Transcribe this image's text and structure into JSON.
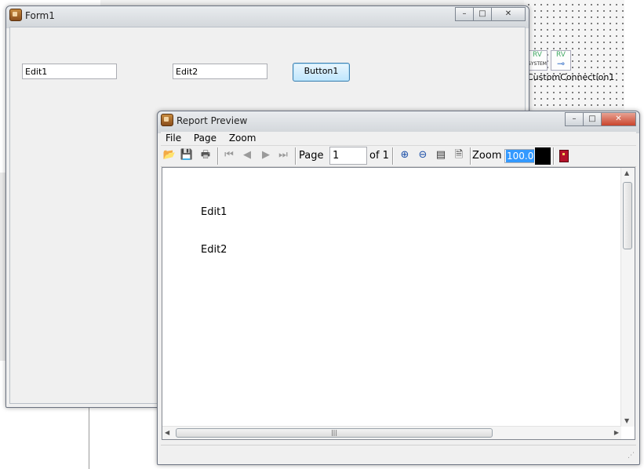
{
  "ide": {
    "component_label": "CustomConnection1",
    "icon1_text": "RV",
    "icon1_sub": "SYSTEM",
    "icon2_text": "RV"
  },
  "form1": {
    "title": "Form1",
    "edit1_value": "Edit1",
    "edit2_value": "Edit2",
    "button_label": "Button1",
    "minimize_icon": "minimize-icon",
    "maximize_icon": "maximize-icon",
    "close_icon": "close-icon"
  },
  "preview": {
    "title": "Report Preview",
    "menu": [
      "File",
      "Page",
      "Zoom"
    ],
    "page_label": "Page",
    "page_value": "1",
    "of_label": "of 1",
    "zoom_label": "Zoom",
    "zoom_value": "100.0",
    "report_lines": [
      "Edit1",
      "Edit2"
    ],
    "toolbar_icons": [
      "open-icon",
      "save-icon",
      "print-icon",
      "first-page-icon",
      "prev-page-icon",
      "next-page-icon",
      "last-page-icon",
      "zoom-in-icon",
      "zoom-out-icon",
      "page-width-icon",
      "whole-page-icon",
      "exit-icon"
    ]
  }
}
